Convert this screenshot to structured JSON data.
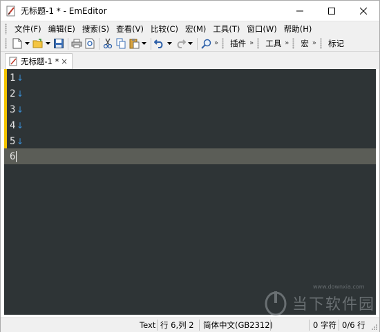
{
  "window": {
    "title": "无标题-1 * - EmEditor",
    "controls": [
      "minimize-icon",
      "maximize-icon",
      "close-icon"
    ]
  },
  "menu": [
    {
      "label": "文件(F)"
    },
    {
      "label": "编辑(E)"
    },
    {
      "label": "搜索(S)"
    },
    {
      "label": "查看(V)"
    },
    {
      "label": "比较(C)"
    },
    {
      "label": "宏(M)"
    },
    {
      "label": "工具(T)"
    },
    {
      "label": "窗口(W)"
    },
    {
      "label": "帮助(H)"
    }
  ],
  "toolbar": {
    "plugins_label": "插件",
    "tools_label": "工具",
    "macro_label": "宏",
    "bookmark_label": "标记",
    "more_glyph": "»"
  },
  "tabs": [
    {
      "title": "无标题-1 *",
      "close": "×"
    }
  ],
  "editor": {
    "lines": [
      {
        "num": "1",
        "eol": "↓"
      },
      {
        "num": "2",
        "eol": "↓"
      },
      {
        "num": "3",
        "eol": "↓"
      },
      {
        "num": "4",
        "eol": "↓"
      },
      {
        "num": "5",
        "eol": "↓"
      },
      {
        "num": "6",
        "eol": ""
      }
    ],
    "current_line": 6,
    "colors": {
      "background": "#2e3436",
      "current_line": "#5b5d57",
      "eol": "#3a8fd6",
      "modified_mark": "#f2c300"
    }
  },
  "watermark": {
    "text": "当下软件园",
    "url": "www.downxia.com"
  },
  "status": {
    "mode": "Text",
    "position": "行 6,列 2",
    "encoding": "简体中文(GB2312)",
    "chars": "0 字符",
    "lines": "0/6 行"
  }
}
